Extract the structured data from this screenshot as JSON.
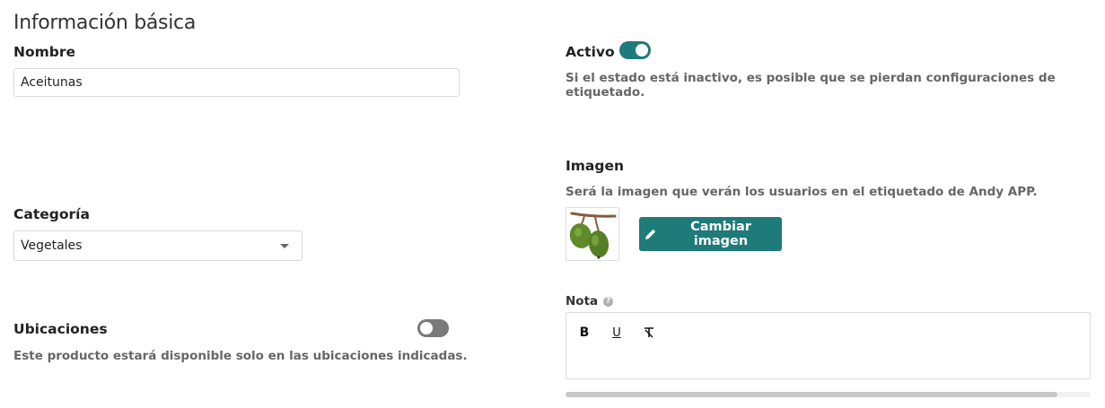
{
  "section": {
    "title": "Información básica"
  },
  "nombre": {
    "label": "Nombre",
    "value": "Aceitunas"
  },
  "activo": {
    "label": "Activo",
    "enabled": true,
    "help": "Si el estado está inactivo, es posible que se pierdan configuraciones de etiquetado."
  },
  "imagen": {
    "label": "Imagen",
    "help": "Será la imagen que verán los usuarios en el etiquetado de Andy APP.",
    "thumbnail_icon": "olives-image",
    "change_button": "Cambiar imagen",
    "change_button_icon": "pencil-icon"
  },
  "categoria": {
    "label": "Categoría",
    "selected": "Vegetales"
  },
  "ubicaciones": {
    "label": "Ubicaciones",
    "enabled": false,
    "help": "Este producto estará disponible solo en las ubicaciones indicadas."
  },
  "nota": {
    "label": "Nota",
    "info_icon": "question-icon",
    "toolbar": {
      "bold": "B",
      "underline": "U",
      "clear_format": "clear-format-icon"
    }
  },
  "colors": {
    "accent": "#1f7a7a",
    "toggle_off": "#7a7a7a"
  }
}
